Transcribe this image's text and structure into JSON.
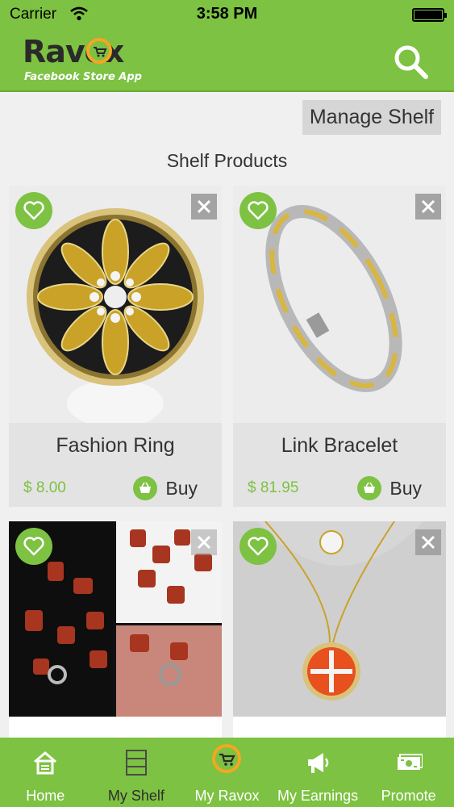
{
  "status_bar": {
    "carrier": "Carrier",
    "time": "3:58 PM"
  },
  "header": {
    "logo_text": "Ravox",
    "logo_subtitle": "Facebook Store App",
    "search_icon": "search-icon"
  },
  "shelf": {
    "manage_label": "Manage Shelf",
    "title": "Shelf Products"
  },
  "products": [
    {
      "name": "Fashion Ring",
      "price": "$ 8.00",
      "buy_label": "Buy"
    },
    {
      "name": "Link Bracelet",
      "price": "$ 81.95",
      "buy_label": "Buy"
    },
    {
      "name": "",
      "price": "",
      "buy_label": ""
    },
    {
      "name": "",
      "price": "",
      "buy_label": ""
    }
  ],
  "tabs": [
    {
      "label": "Home",
      "icon": "home-icon"
    },
    {
      "label": "My Shelf",
      "icon": "shelf-icon"
    },
    {
      "label": "My Ravox",
      "icon": "ravox-cart-icon"
    },
    {
      "label": "My Earnings",
      "icon": "megaphone-icon"
    },
    {
      "label": "Promote",
      "icon": "money-icon"
    }
  ],
  "colors": {
    "brand_green": "#7dc242",
    "card_bg": "#e3e3e3",
    "page_bg": "#f0f0f0"
  }
}
